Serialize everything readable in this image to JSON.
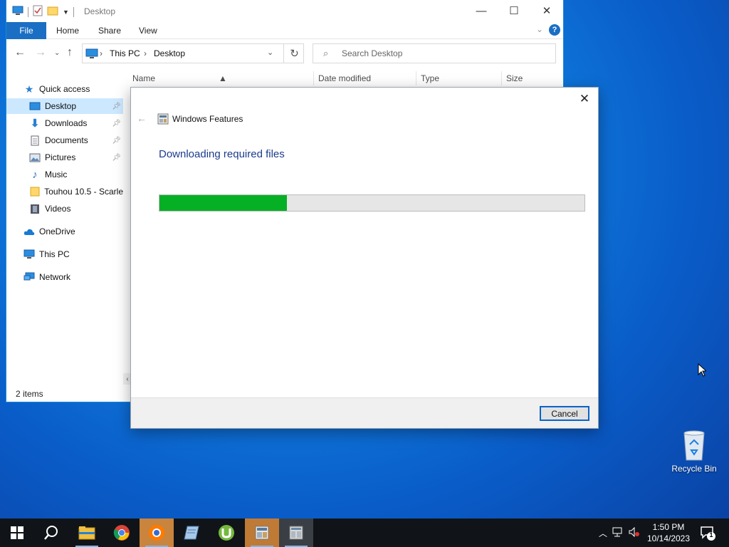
{
  "explorer": {
    "title": "Desktop",
    "ribbon_tabs": {
      "file": "File",
      "home": "Home",
      "share": "Share",
      "view": "View"
    },
    "address": {
      "this_pc": "This PC",
      "desktop": "Desktop"
    },
    "search_placeholder": "Search Desktop",
    "columns": {
      "name": "Name",
      "date_modified": "Date modified",
      "type": "Type",
      "size": "Size"
    },
    "nav": {
      "quick_access": "Quick access",
      "desktop": "Desktop",
      "downloads": "Downloads",
      "documents": "Documents",
      "pictures": "Pictures",
      "music": "Music",
      "touhou": "Touhou 10.5 - Scarle",
      "videos": "Videos",
      "onedrive": "OneDrive",
      "this_pc": "This PC",
      "network": "Network"
    },
    "status": "2 items"
  },
  "dialog": {
    "title": "Windows Features",
    "heading": "Downloading required files",
    "progress": 0.3,
    "cancel_label": "Cancel"
  },
  "desktop": {
    "recycle_bin_label": "Recycle Bin"
  },
  "taskbar": {
    "time": "1:50 PM",
    "date": "10/14/2023",
    "notification_count": "1"
  },
  "colors": {
    "accent": "#1a6fc4",
    "progress_fill": "#06b025",
    "selected_nav": "#cce8ff",
    "active_taskbar": "#bf7a36"
  }
}
